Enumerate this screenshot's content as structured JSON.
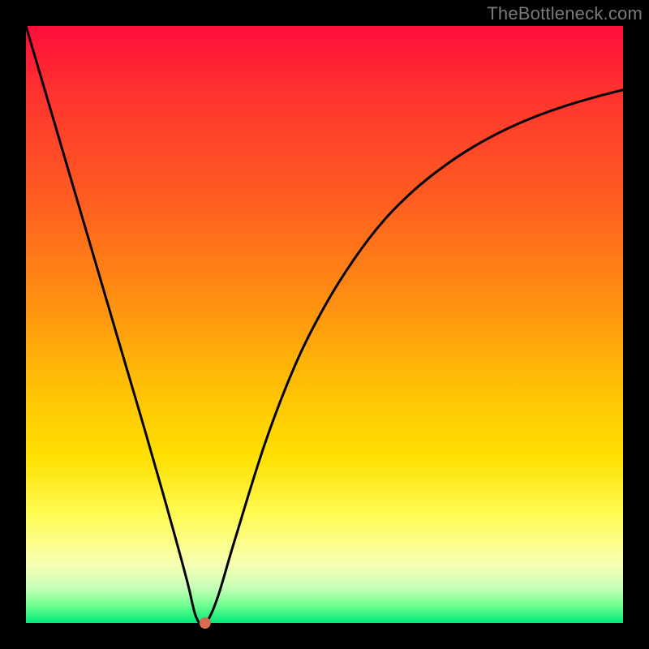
{
  "watermark": "TheBottleneck.com",
  "chart_data": {
    "type": "line",
    "title": "",
    "xlabel": "",
    "ylabel": "",
    "xlim": [
      0,
      100
    ],
    "ylim": [
      0,
      100
    ],
    "grid": false,
    "legend": false,
    "series": [
      {
        "name": "curve",
        "x": [
          0,
          5,
          10,
          15,
          20,
          24,
          27,
          28.5,
          30,
          32,
          35,
          40,
          45,
          50,
          55,
          60,
          65,
          70,
          75,
          80,
          85,
          90,
          95,
          100
        ],
        "values": [
          100,
          83,
          66,
          49,
          32,
          18,
          7,
          1,
          0,
          4,
          14,
          30,
          43,
          53,
          61,
          67.5,
          72.5,
          76.5,
          79.8,
          82.5,
          84.7,
          86.5,
          88,
          89.3
        ]
      }
    ],
    "marker": {
      "x": 30,
      "y": 0,
      "color": "#d96a4f"
    },
    "background_gradient": {
      "top": "#ff0c3b",
      "bottom": "#00e878"
    }
  }
}
